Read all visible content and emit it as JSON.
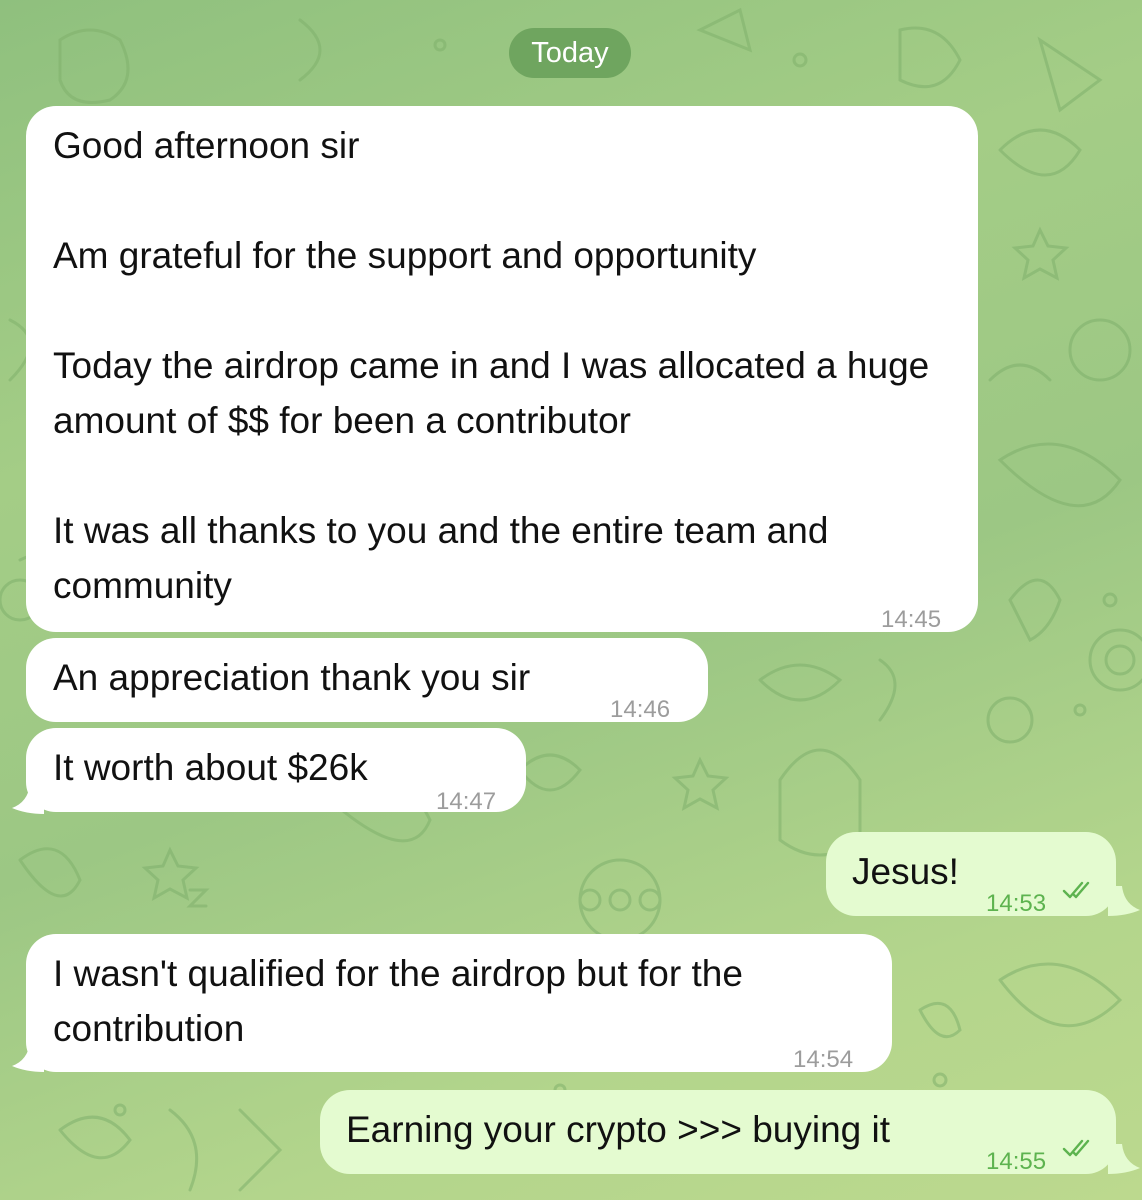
{
  "date_label": "Today",
  "messages": [
    {
      "direction": "incoming",
      "text": "Good afternoon sir\n\nAm grateful for the support and opportunity\n\nToday the airdrop came in and I was allocated a huge amount of  $$ for been a contributor\n\nIt was all thanks to you and the entire team and community",
      "time": "14:45"
    },
    {
      "direction": "incoming",
      "text": "An appreciation thank you sir",
      "time": "14:46"
    },
    {
      "direction": "incoming",
      "text": "It worth about $26k",
      "time": "14:47"
    },
    {
      "direction": "outgoing",
      "text": "Jesus!",
      "time": "14:53",
      "status_icon": "double-check-read-icon"
    },
    {
      "direction": "incoming",
      "text": "I wasn't qualified for the airdrop but for the contribution",
      "time": "14:54"
    },
    {
      "direction": "outgoing",
      "text": "Earning your crypto >>> buying it",
      "time": "14:55",
      "status_icon": "double-check-read-icon"
    }
  ],
  "colors": {
    "background": "#9cc784",
    "incoming_bubble": "#ffffff",
    "outgoing_bubble": "#e4fbd0",
    "date_pill": "#6fa55f",
    "read_check": "#5db34f",
    "timestamp_in": "#9c9c9c"
  }
}
